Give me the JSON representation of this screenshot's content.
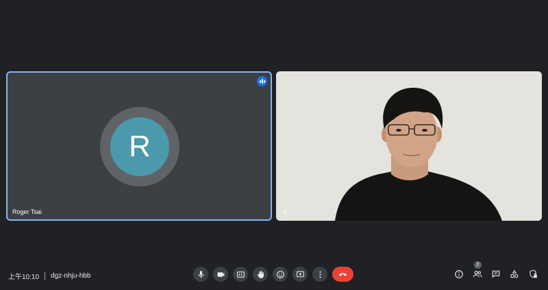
{
  "participants": [
    {
      "name": "Roger Tsai",
      "initial": "R",
      "avatar_color": "#4a9aab",
      "speaking": true
    },
    {
      "name": "",
      "video_on": true
    }
  ],
  "meeting": {
    "time": "上午10:10",
    "code": "dgz-nhju-hbb"
  },
  "controls": [
    "microphone-icon",
    "camera-icon",
    "captions-icon",
    "raise-hand-icon",
    "emoji-icon",
    "present-screen-icon",
    "more-options-icon",
    "hang-up-icon"
  ],
  "side_panel": {
    "people_count": "2",
    "icons": [
      "info-icon",
      "people-icon",
      "chat-icon",
      "activities-icon",
      "host-controls-icon"
    ]
  },
  "colors": {
    "background": "#202124",
    "tile": "#3c4043",
    "active_border": "#8ab4f8",
    "hangup": "#ea4335"
  }
}
